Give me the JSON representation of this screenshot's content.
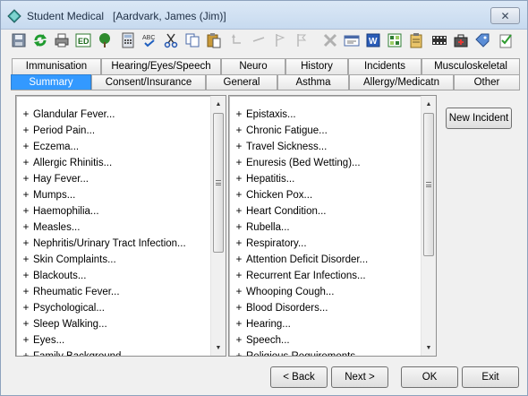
{
  "window": {
    "title": "Student Medical   [Aardvark, James (Jim)]",
    "close_glyph": "✕"
  },
  "toolbar": {
    "icons": [
      "save-icon",
      "refresh-icon",
      "print-icon",
      "edit-icon",
      "tree-icon",
      "calculator-icon",
      "spellcheck-icon",
      "cut-icon",
      "copy-icon",
      "paste-icon",
      "undo-icon",
      "redo-icon",
      "flag-icon",
      "flag-outline-icon",
      "delete-icon",
      "card-icon",
      "word-icon",
      "spreadsheet-icon",
      "clipboard-icon",
      "film-icon",
      "medical-kit-icon",
      "tag-icon",
      "checklist-icon"
    ]
  },
  "tabs": {
    "row_top": [
      "Immunisation",
      "Hearing/Eyes/Speech",
      "Neuro",
      "History",
      "Incidents",
      "Musculoskeletal"
    ],
    "row_bottom": [
      "Summary",
      "Consent/Insurance",
      "General",
      "Asthma",
      "Allergy/Medicatn",
      "Other"
    ],
    "active": "Summary"
  },
  "left_list": {
    "items": [
      "Glandular Fever...",
      "Period Pain...",
      "Eczema...",
      "Allergic Rhinitis...",
      "Hay Fever...",
      "Mumps...",
      "Haemophilia...",
      "Measles...",
      "Nephritis/Urinary Tract Infection...",
      "Skin Complaints...",
      "Blackouts...",
      "Rheumatic Fever...",
      "Psychological...",
      "Sleep Walking...",
      "Eyes...",
      "Family Background..."
    ],
    "expander": "+",
    "scroll_up": "▲",
    "scroll_down": "▼"
  },
  "right_list": {
    "items": [
      "Epistaxis...",
      "Chronic Fatigue...",
      "Travel Sickness...",
      "Enuresis (Bed Wetting)...",
      "Hepatitis...",
      "Chicken Pox...",
      "Heart Condition...",
      "Rubella...",
      "Respiratory...",
      "Attention Deficit Disorder...",
      "Recurrent Ear Infections...",
      "Whooping Cough...",
      "Blood Disorders...",
      "Hearing...",
      "Speech...",
      "Religious Requirements..."
    ],
    "expander": "+",
    "scroll_up": "▲",
    "scroll_down": "▼"
  },
  "actions": {
    "new_incident": "New Incident",
    "back": "< Back",
    "next": "Next >",
    "ok": "OK",
    "exit": "Exit"
  }
}
